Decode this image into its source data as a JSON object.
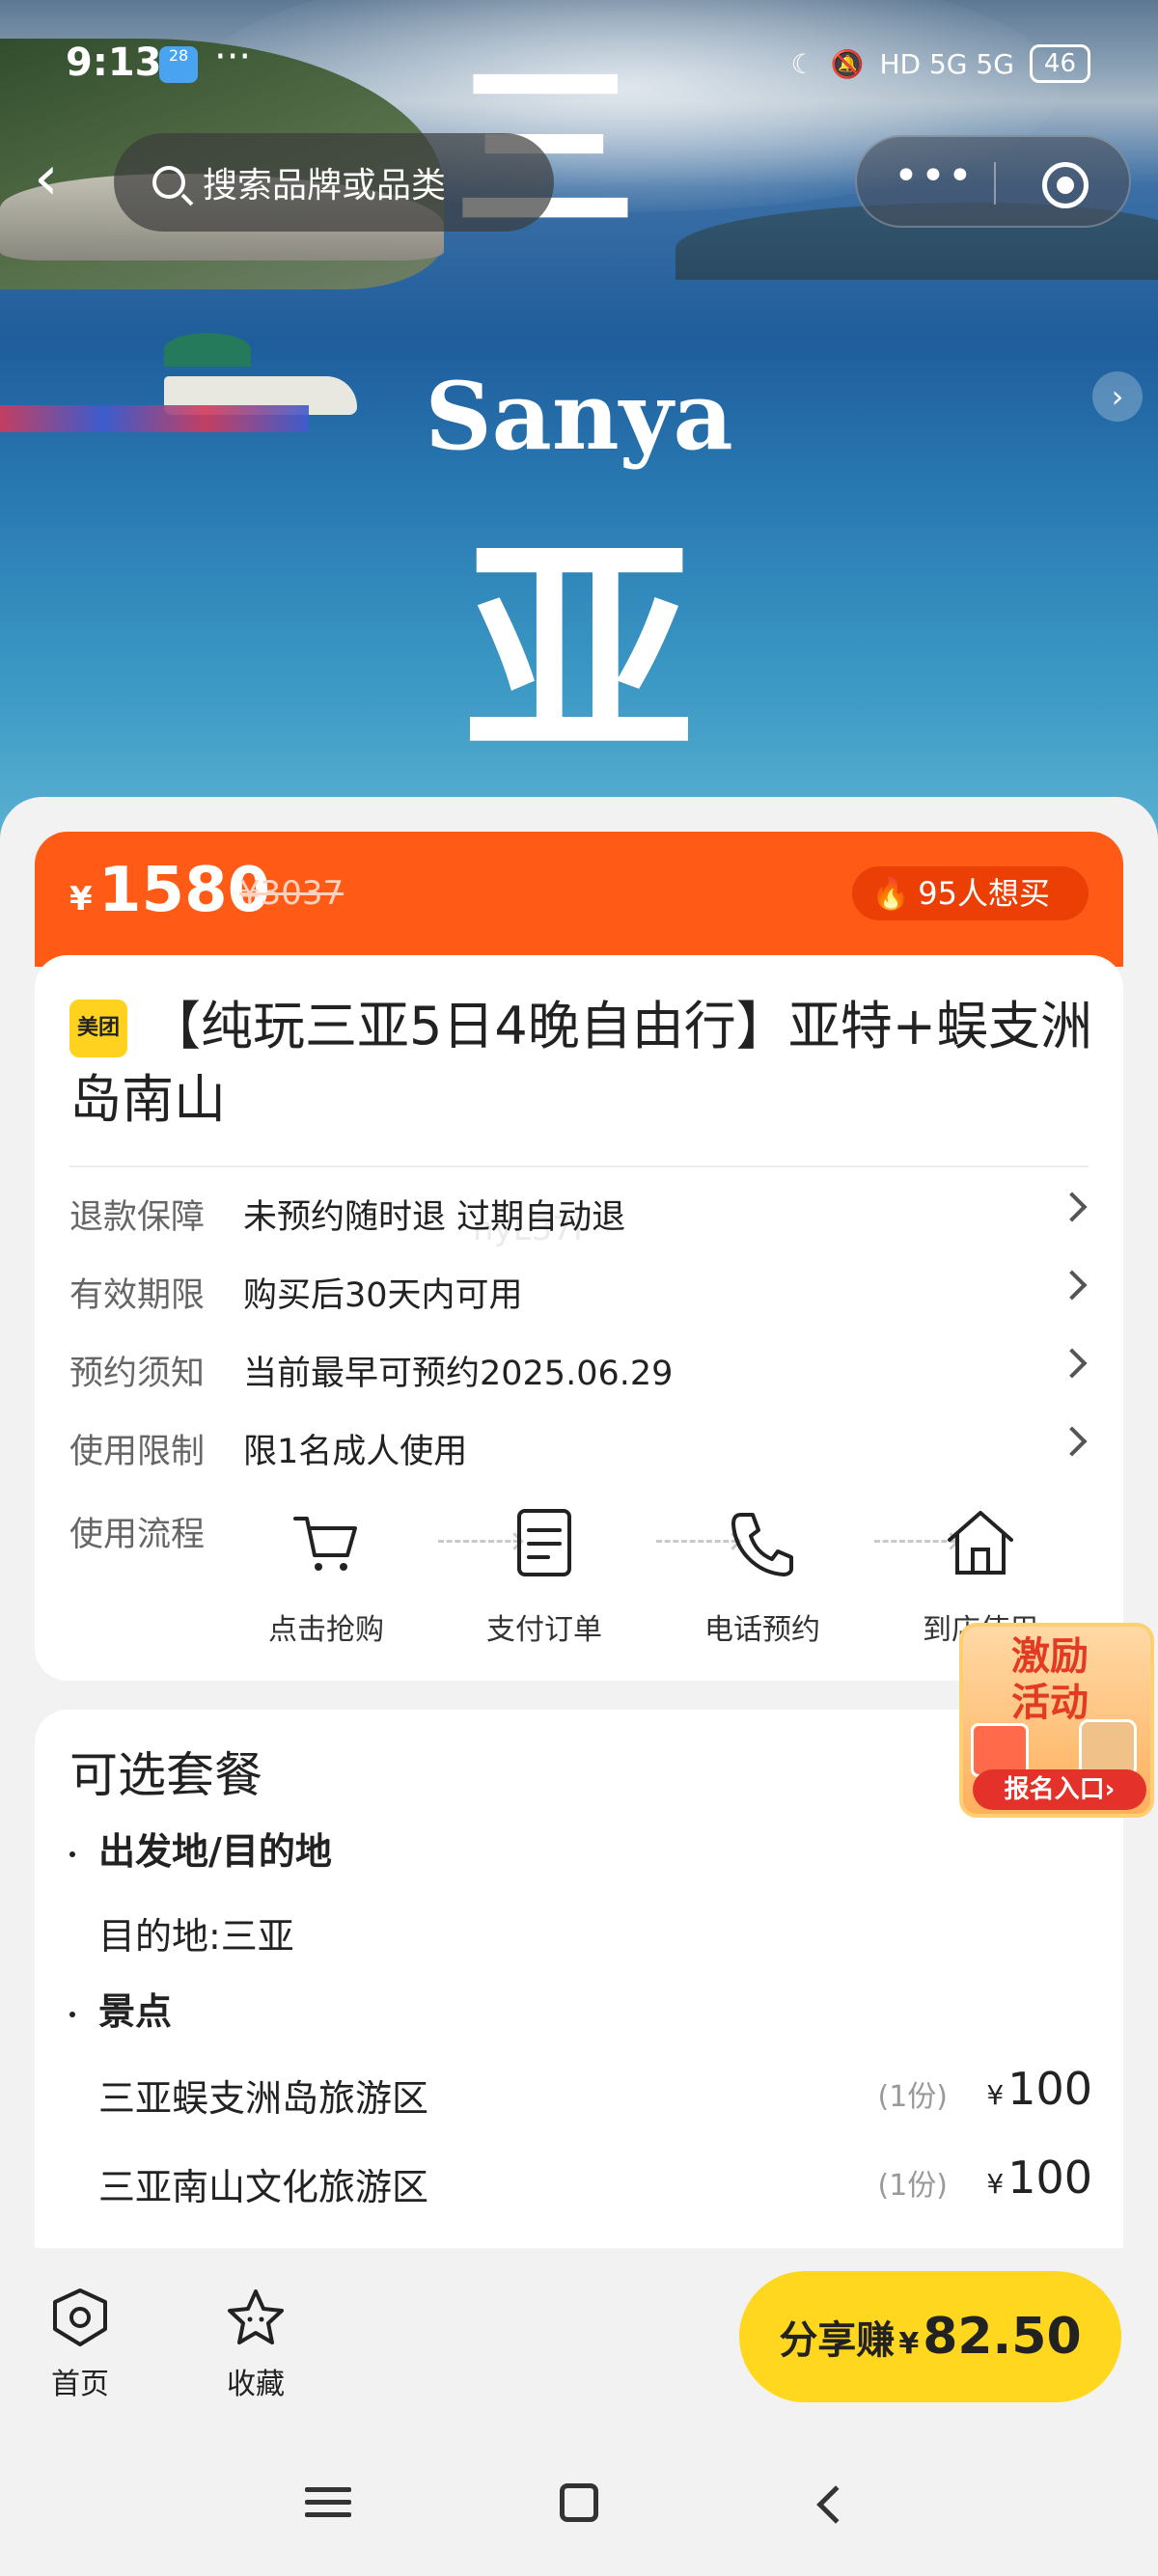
{
  "status_bar": {
    "time": "9:13",
    "app_badge": "28",
    "more_dots": "···",
    "network": "HD 5G 5G",
    "battery": "46"
  },
  "header": {
    "search_placeholder": "搜索品牌或品类",
    "more_label": "•••"
  },
  "hero": {
    "kanji_top": "三",
    "city_en": "Sanya",
    "kanji_bottom": "亚",
    "carousel_arrow": "›"
  },
  "price": {
    "currency": "¥",
    "current": "1580",
    "original": "¥3037",
    "wants_icon": "fire-icon",
    "wants_text": "95人想买"
  },
  "product": {
    "brand_badge": "美团",
    "title": "【纯玩三亚5日4晚自由行】亚特+蜈支洲岛南山"
  },
  "info_rows": [
    {
      "key": "退款保障",
      "value": "未预约随时退 过期自动退"
    },
    {
      "key": "有效期限",
      "value": "购买后30天内可用"
    },
    {
      "key": "预约须知",
      "value": "当前最早可预约2025.06.29"
    },
    {
      "key": "使用限制",
      "value": "限1名成人使用"
    }
  ],
  "flow": {
    "label": "使用流程",
    "steps": [
      {
        "icon": "cart-icon",
        "label": "点击抢购"
      },
      {
        "icon": "document-icon",
        "label": "支付订单"
      },
      {
        "icon": "phone-icon",
        "label": "电话预约"
      },
      {
        "icon": "home-icon",
        "label": "到店使用"
      }
    ]
  },
  "packages": {
    "heading": "可选套餐",
    "origin_section": "出发地/目的地",
    "destination": "目的地:三亚",
    "attractions_section": "景点",
    "items": [
      {
        "name": "三亚蜈支洲岛旅游区",
        "count": "(1份)",
        "currency": "¥",
        "price": "100"
      },
      {
        "name": "三亚南山文化旅游区",
        "count": "(1份)",
        "currency": "¥",
        "price": "100"
      }
    ]
  },
  "promo": {
    "line1": "激励",
    "line2": "活动",
    "button": "报名入口›"
  },
  "bottom_bar": {
    "home_label": "首页",
    "fav_label": "收藏",
    "share_label": "分享赚",
    "share_currency": "¥",
    "share_amount": "82.50"
  },
  "watermark": "nyL37I"
}
